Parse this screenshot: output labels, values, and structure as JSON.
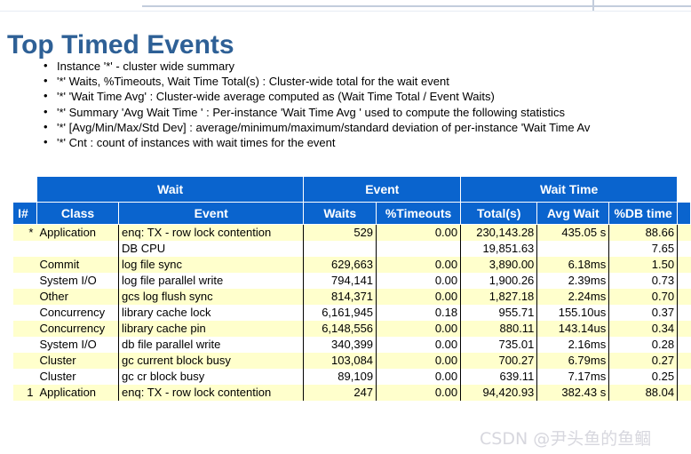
{
  "page": {
    "title": "Top Timed Events",
    "title_color": "#2e6096",
    "header_color": "#0a64ce",
    "alt_row_color": "#ffffcc"
  },
  "notes": [
    "Instance '*' - cluster wide summary",
    "'*' Waits, %Timeouts, Wait Time Total(s) : Cluster-wide total for the wait event",
    "'*' 'Wait Time Avg' : Cluster-wide average computed as (Wait Time Total / Event Waits)",
    "'*' Summary 'Avg Wait Time ' : Per-instance 'Wait Time Avg ' used to compute the following statistics",
    "'*' [Avg/Min/Max/Std Dev] : average/minimum/maximum/standard deviation of per-instance 'Wait Time Av",
    "'*' Cnt : count of instances with wait times for the event"
  ],
  "table": {
    "group_headers": [
      {
        "label": "Wait",
        "span": 2
      },
      {
        "label": "Event",
        "span": 2
      },
      {
        "label": "Wait Time",
        "span": 3
      }
    ],
    "columns": [
      "I#",
      "Class",
      "Event",
      "Waits",
      "%Timeouts",
      "Total(s)",
      "Avg Wait",
      "%DB time"
    ],
    "rows": [
      {
        "inum": "*",
        "class": "Application",
        "event": "enq: TX - row lock contention",
        "waits": "529",
        "timeouts": "0.00",
        "total": "230,143.28",
        "avg": "435.05 s",
        "dbtime": "88.66",
        "alt": true
      },
      {
        "inum": "",
        "class": "",
        "event": "DB CPU",
        "waits": "",
        "timeouts": "",
        "total": "19,851.63",
        "avg": "",
        "dbtime": "7.65",
        "alt": false
      },
      {
        "inum": "",
        "class": "Commit",
        "event": "log file sync",
        "waits": "629,663",
        "timeouts": "0.00",
        "total": "3,890.00",
        "avg": "6.18ms",
        "dbtime": "1.50",
        "alt": true
      },
      {
        "inum": "",
        "class": "System I/O",
        "event": "log file parallel write",
        "waits": "794,141",
        "timeouts": "0.00",
        "total": "1,900.26",
        "avg": "2.39ms",
        "dbtime": "0.73",
        "alt": false
      },
      {
        "inum": "",
        "class": "Other",
        "event": "gcs log flush sync",
        "waits": "814,371",
        "timeouts": "0.00",
        "total": "1,827.18",
        "avg": "2.24ms",
        "dbtime": "0.70",
        "alt": true
      },
      {
        "inum": "",
        "class": "Concurrency",
        "event": "library cache lock",
        "waits": "6,161,945",
        "timeouts": "0.18",
        "total": "955.71",
        "avg": "155.10us",
        "dbtime": "0.37",
        "alt": false
      },
      {
        "inum": "",
        "class": "Concurrency",
        "event": "library cache pin",
        "waits": "6,148,556",
        "timeouts": "0.00",
        "total": "880.11",
        "avg": "143.14us",
        "dbtime": "0.34",
        "alt": true
      },
      {
        "inum": "",
        "class": "System I/O",
        "event": "db file parallel write",
        "waits": "340,399",
        "timeouts": "0.00",
        "total": "735.01",
        "avg": "2.16ms",
        "dbtime": "0.28",
        "alt": false
      },
      {
        "inum": "",
        "class": "Cluster",
        "event": "gc current block busy",
        "waits": "103,084",
        "timeouts": "0.00",
        "total": "700.27",
        "avg": "6.79ms",
        "dbtime": "0.27",
        "alt": true
      },
      {
        "inum": "",
        "class": "Cluster",
        "event": "gc cr block busy",
        "waits": "89,109",
        "timeouts": "0.00",
        "total": "639.11",
        "avg": "7.17ms",
        "dbtime": "0.25",
        "alt": false
      },
      {
        "inum": "1",
        "class": "Application",
        "event": "enq: TX - row lock contention",
        "waits": "247",
        "timeouts": "0.00",
        "total": "94,420.93",
        "avg": "382.43 s",
        "dbtime": "88.04",
        "alt": true
      }
    ]
  },
  "watermark": "CSDN @尹头鱼的鱼鲴"
}
